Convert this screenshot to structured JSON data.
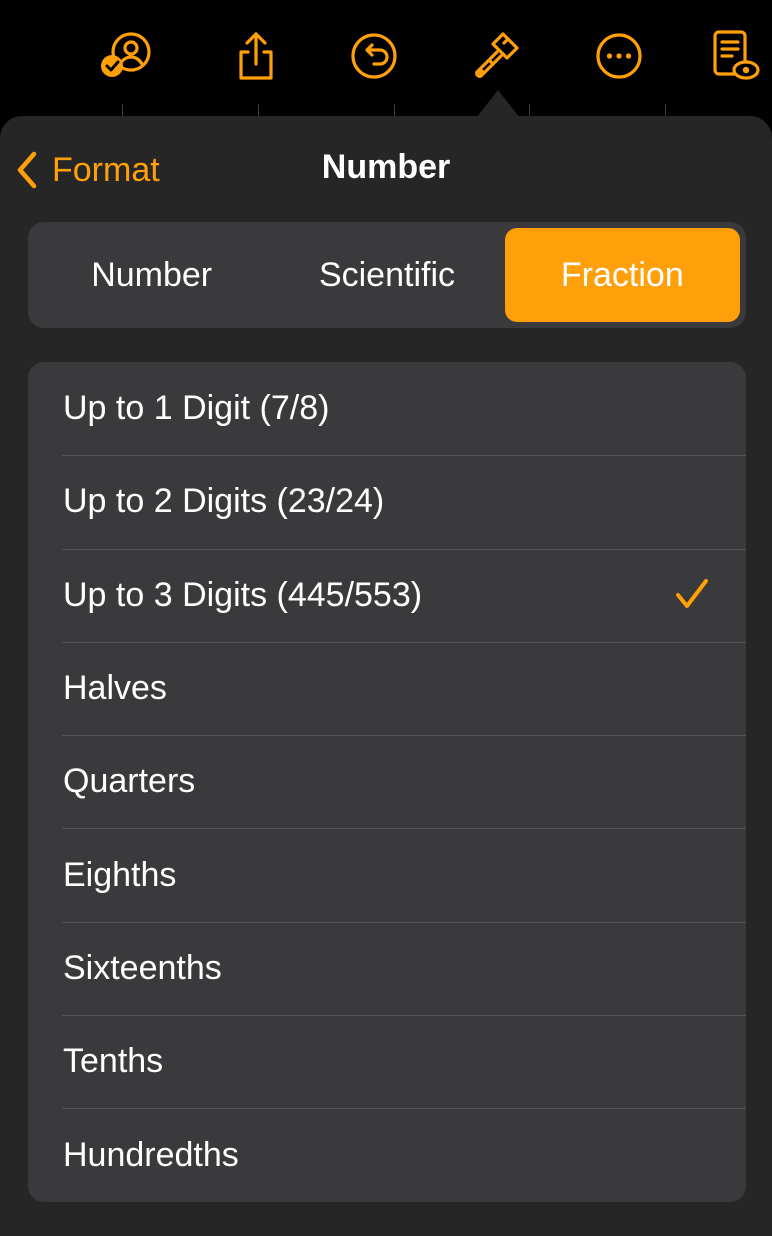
{
  "toolbar": {
    "icons": [
      "collaborate-icon",
      "share-icon",
      "undo-icon",
      "format-brush-icon",
      "more-icon",
      "reading-view-icon"
    ],
    "accent_color": "#ff9f0a"
  },
  "nav": {
    "back_label": "Format",
    "title": "Number"
  },
  "segments": {
    "items": [
      "Number",
      "Scientific",
      "Fraction"
    ],
    "selected": "Fraction"
  },
  "options": {
    "items": [
      "Up to 1 Digit (7/8)",
      "Up to 2 Digits (23/24)",
      "Up to 3 Digits (445/553)",
      "Halves",
      "Quarters",
      "Eighths",
      "Sixteenths",
      "Tenths",
      "Hundredths"
    ],
    "selected": "Up to 3 Digits (445/553)"
  },
  "colors": {
    "accent": "#ff9f0a",
    "popover_bg": "#262626",
    "cell_bg": "#3a3a3c",
    "separator": "#545458"
  }
}
